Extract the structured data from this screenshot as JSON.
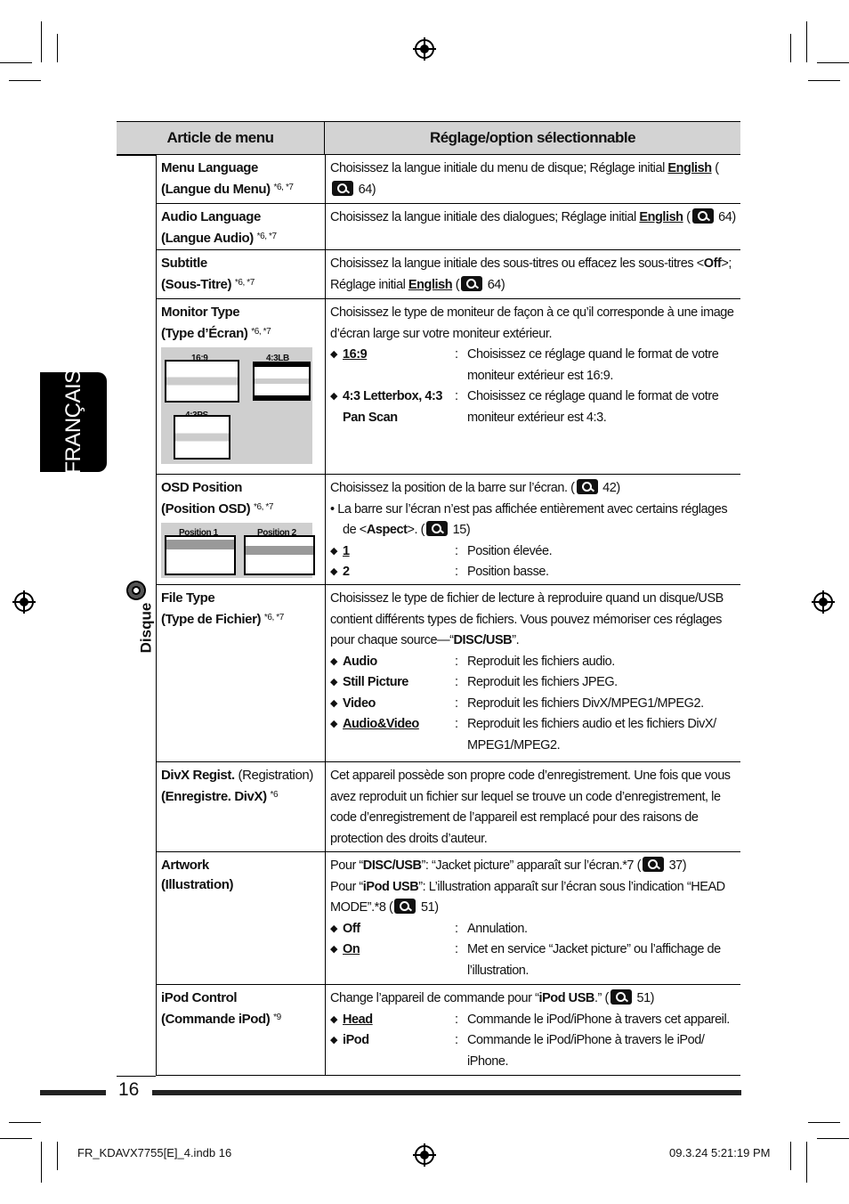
{
  "side_tab": "FRANÇAIS",
  "section_label": "Disque",
  "header": {
    "col1": "Article de menu",
    "col2": "Réglage/option sélectionnable"
  },
  "rows": [
    {
      "h": 55,
      "title": [
        "Menu Language",
        "(Langue du Menu)"
      ],
      "notes": "*6, *7",
      "desc": [
        {
          "type": "p",
          "parts": [
            {
              "t": "Choisissez la langue initiale du menu de disque; Réglage initial "
            },
            {
              "t": "English",
              "b": 1,
              "u": 1
            },
            {
              "t": " ("
            },
            {
              "ref": 1
            },
            {
              "t": " 64)"
            }
          ]
        }
      ]
    },
    {
      "h": 52,
      "title": [
        "Audio Language",
        "(Langue Audio)"
      ],
      "notes": "*6, *7",
      "desc": [
        {
          "type": "p",
          "parts": [
            {
              "t": "Choisissez la langue initiale des dialogues; Réglage initial "
            },
            {
              "t": "English",
              "b": 1,
              "u": 1
            },
            {
              "t": " ("
            },
            {
              "ref": 1
            },
            {
              "t": " 64)"
            }
          ]
        }
      ]
    },
    {
      "h": 55,
      "title": [
        "Subtitle",
        "(Sous-Titre)"
      ],
      "notes": "*6, *7",
      "desc": [
        {
          "type": "p",
          "parts": [
            {
              "t": "Choisissez la langue initiale des sous-titres ou effacez les sous-titres <"
            },
            {
              "t": "Off",
              "b": 1
            },
            {
              "t": ">; Réglage initial "
            },
            {
              "t": "English",
              "b": 1,
              "u": 1
            },
            {
              "t": " ("
            },
            {
              "ref": 1
            },
            {
              "t": " 64)"
            }
          ]
        }
      ]
    },
    {
      "h": 197,
      "title": [
        "Monitor Type",
        "(Type d’Écran)"
      ],
      "notes": "*6, *7",
      "illus": "monitor",
      "illus_labels": [
        "16:9",
        "4:3LB",
        "4:3PS"
      ],
      "desc": [
        {
          "type": "p",
          "parts": [
            {
              "t": "Choisissez le type de moniteur de façon à ce qu’il corresponde à une image d’écran large sur votre moniteur extérieur."
            }
          ]
        },
        {
          "type": "opt",
          "label": "16:9",
          "u": 1,
          "text": "Choisissez ce réglage quand le format de votre moniteur extérieur est 16:9."
        },
        {
          "type": "opt",
          "label": "4:3 Letterbox, 4:3 Pan Scan",
          "text": "Choisissez ce réglage quand le format de votre moniteur extérieur est 4:3."
        }
      ]
    },
    {
      "h": 124,
      "title": [
        "OSD Position",
        "(Position OSD)"
      ],
      "notes": "*6, *7",
      "illus": "osd",
      "illus_labels": [
        "Position 1",
        "Position 2"
      ],
      "desc": [
        {
          "type": "p",
          "parts": [
            {
              "t": "Choisissez la position de la barre sur l’écran. ("
            },
            {
              "ref": 1
            },
            {
              "t": " 42)"
            }
          ]
        },
        {
          "type": "bullet",
          "parts": [
            {
              "t": "• La barre sur l’écran n’est pas affichée entièrement avec certains réglages de <"
            },
            {
              "t": "Aspect",
              "b": 1
            },
            {
              "t": ">. ("
            },
            {
              "ref": 1
            },
            {
              "t": " 15)"
            }
          ]
        },
        {
          "type": "opt",
          "label": "1",
          "u": 1,
          "text": "Position élevée."
        },
        {
          "type": "opt",
          "label": "2",
          "text": "Position basse."
        }
      ]
    },
    {
      "h": 199,
      "title": [
        "File Type",
        "(Type de Fichier)"
      ],
      "notes": "*6, *7",
      "desc": [
        {
          "type": "p",
          "parts": [
            {
              "t": "Choisissez le type de fichier de lecture à reproduire quand un disque/USB contient différents types de fichiers. Vous pouvez mémoriser ces réglages pour chaque source—“"
            },
            {
              "t": "DISC/USB",
              "b": 1
            },
            {
              "t": "”."
            }
          ]
        },
        {
          "type": "opt",
          "label": "Audio",
          "text": "Reproduit les fichiers audio."
        },
        {
          "type": "opt",
          "label": "Still Picture",
          "text": "Reproduit les fichiers JPEG."
        },
        {
          "type": "opt",
          "label": "Video",
          "text": "Reproduit les fichiers DivX/MPEG1/MPEG2."
        },
        {
          "type": "opt",
          "label": "Audio&Video",
          "u": 1,
          "text": "Reproduit les fichiers audio et les fichiers DivX/ MPEG1/MPEG2."
        }
      ]
    },
    {
      "h": 101,
      "title": [
        "DivX Regist.",
        "(Enregistre. DivX)"
      ],
      "title_extra": " (Registration)",
      "notes": "*6",
      "desc": [
        {
          "type": "p",
          "parts": [
            {
              "t": "Cet appareil possède son propre code d’enregistrement. Une fois que vous avez reproduit un fichier sur lequel se trouve un code d’enregistrement, le code d’enregistrement de l’appareil est remplacé pour des raisons de protection des droits d’auteur."
            }
          ]
        }
      ]
    },
    {
      "h": 149,
      "title": [
        "Artwork",
        "(Illustration)"
      ],
      "notes": "",
      "desc": [
        {
          "type": "p",
          "parts": [
            {
              "t": "Pour “"
            },
            {
              "t": "DISC/USB",
              "b": 1
            },
            {
              "t": "”: “Jacket picture” apparaît sur l’écran.*7 ("
            },
            {
              "ref": 1
            },
            {
              "t": " 37)"
            }
          ]
        },
        {
          "type": "p",
          "parts": [
            {
              "t": "Pour “"
            },
            {
              "t": "iPod USB",
              "b": 1
            },
            {
              "t": "”: L’illustration apparaît sur l’écran sous l’indication “HEAD MODE”.*8 ("
            },
            {
              "ref": 1
            },
            {
              "t": " 51)"
            }
          ]
        },
        {
          "type": "opt",
          "label": "Off",
          "text": "Annulation."
        },
        {
          "type": "opt",
          "label": "On",
          "u": 1,
          "text": "Met en service “Jacket picture” ou l’affichage de l’illustration."
        }
      ]
    },
    {
      "h": 102,
      "title": [
        "iPod Control",
        "(Commande iPod)"
      ],
      "notes": "*9",
      "desc": [
        {
          "type": "p",
          "parts": [
            {
              "t": "Change l’appareil de commande pour “"
            },
            {
              "t": "iPod USB",
              "b": 1
            },
            {
              "t": ".” ("
            },
            {
              "ref": 1
            },
            {
              "t": " 51)"
            }
          ]
        },
        {
          "type": "opt",
          "label": "Head",
          "u": 1,
          "text": "Commande le iPod/iPhone à travers cet appareil."
        },
        {
          "type": "opt",
          "label": "iPod",
          "text": "Commande le iPod/iPhone à travers le iPod/ iPhone."
        }
      ]
    }
  ],
  "footer": {
    "page": "16",
    "file": "FR_KDAVX7755[E]_4.indb   16",
    "date": "09.3.24   5:21:19 PM"
  },
  "icons": {
    "ref": "reference-magnifier-icon",
    "disc": "disc-icon",
    "option": "diamond-bullet-icon"
  }
}
